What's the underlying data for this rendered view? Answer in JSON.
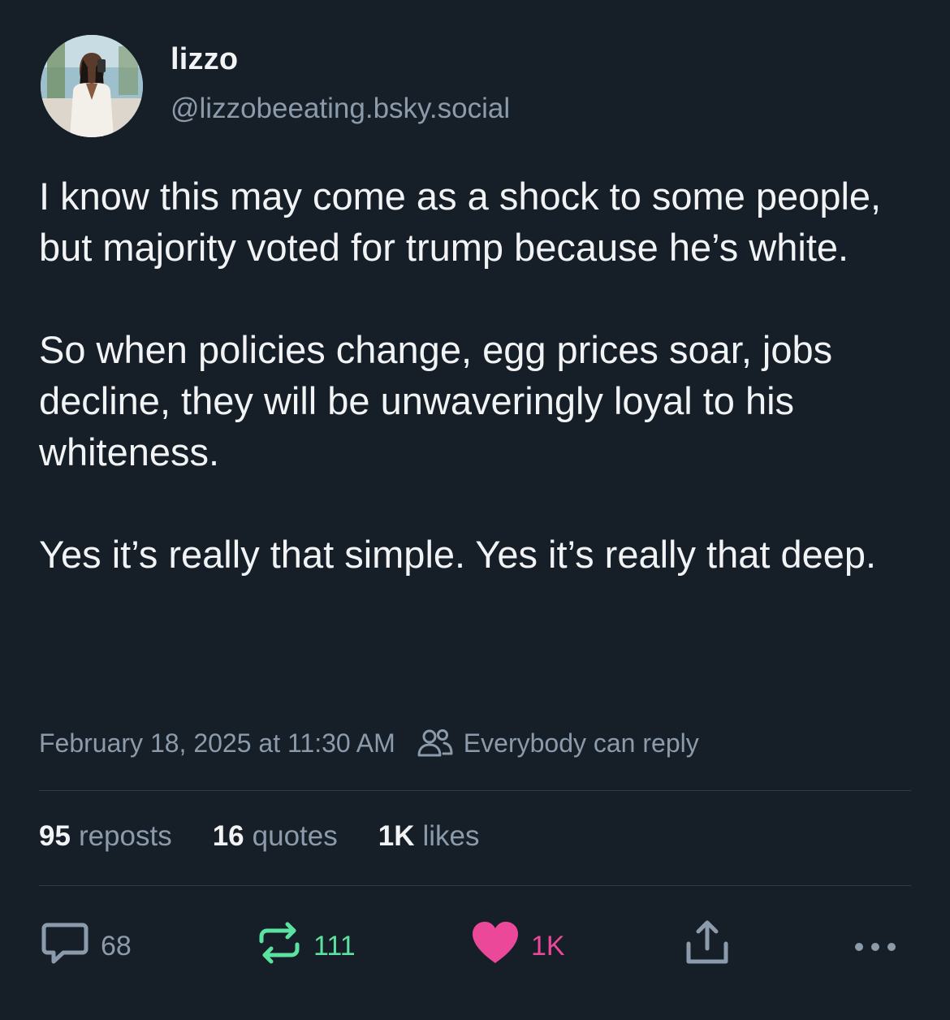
{
  "post": {
    "author": {
      "display_name": "lizzo",
      "handle": "@lizzobeeating.bsky.social"
    },
    "paragraphs": [
      "I know this may come as a shock to some people, but majority voted for trump because he’s white.",
      "So when policies change, egg prices soar, jobs decline, they will be unwaveringly loyal to his whiteness.",
      "Yes it’s really that simple. Yes it’s really that deep."
    ],
    "timestamp": "February 18, 2025 at 11:30 AM",
    "reply_setting": "Everybody can reply",
    "stats": {
      "reposts": {
        "count": "95",
        "label": "reposts"
      },
      "quotes": {
        "count": "16",
        "label": "quotes"
      },
      "likes": {
        "count": "1K",
        "label": "likes"
      }
    },
    "actions": {
      "reply_count": "68",
      "repost_count": "111",
      "like_count": "1K"
    }
  },
  "icons": {
    "reply": "speech-bubble-icon",
    "repost": "repost-arrows-icon",
    "like": "heart-icon",
    "share": "share-icon",
    "more": "more-dots-icon",
    "audience": "people-icon"
  },
  "colors": {
    "background": "#161e27",
    "text_primary": "#f1f3f5",
    "text_secondary": "#8c9bab",
    "repost_active": "#5ce2a0",
    "like_active": "#ec4899",
    "divider": "#2e3b4a"
  }
}
